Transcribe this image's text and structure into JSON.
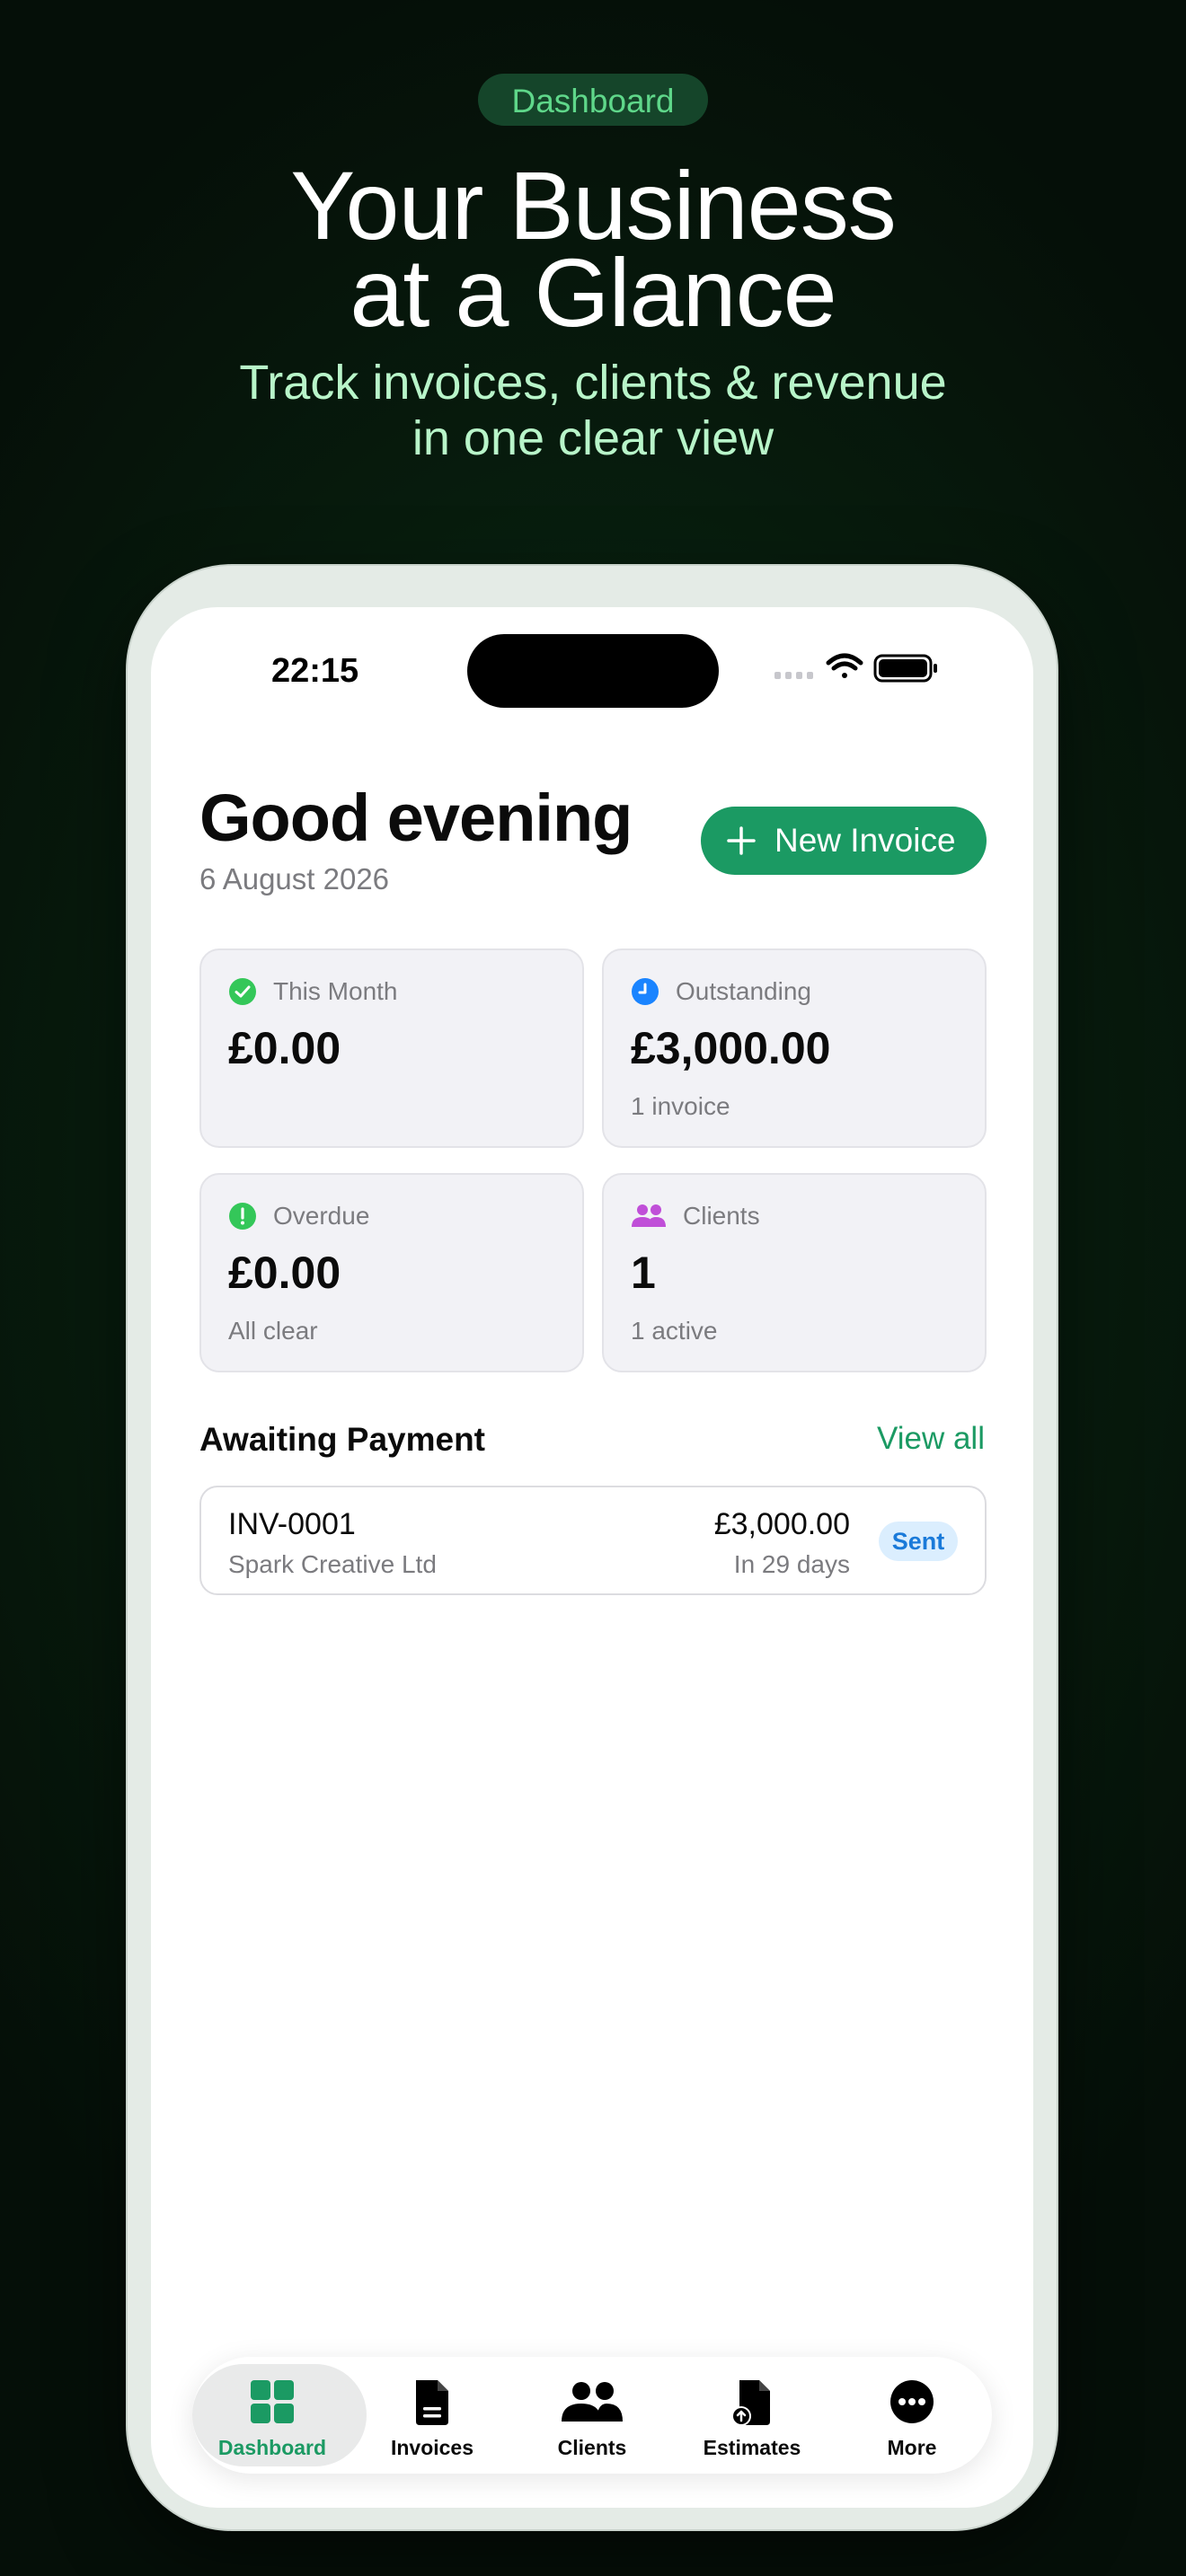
{
  "hero": {
    "pill": "Dashboard",
    "title_line1": "Your Business",
    "title_line2": "at a Glance",
    "subtitle_line1": "Track invoices, clients & revenue",
    "subtitle_line2": "in one clear view"
  },
  "status_bar": {
    "time": "22:15",
    "icons": [
      "signal-icon",
      "wifi-icon",
      "battery-icon"
    ]
  },
  "header": {
    "greeting": "Good evening",
    "date": "6 August 2026",
    "new_invoice_label": "New Invoice"
  },
  "stats": {
    "this_month": {
      "label": "This Month",
      "value": "£0.00",
      "sub": "",
      "icon": "check-circle-icon",
      "color": "#34c759"
    },
    "outstanding": {
      "label": "Outstanding",
      "value": "£3,000.00",
      "sub": "1 invoice",
      "icon": "clock-icon",
      "color": "#1a84ff"
    },
    "overdue": {
      "label": "Overdue",
      "value": "£0.00",
      "sub": "All clear",
      "icon": "exclamation-circle-icon",
      "color": "#34c759"
    },
    "clients": {
      "label": "Clients",
      "value": "1",
      "sub": "1 active",
      "icon": "people-icon",
      "color": "#c04fd8"
    }
  },
  "awaiting": {
    "title": "Awaiting Payment",
    "view_all": "View all",
    "invoices": [
      {
        "number": "INV-0001",
        "client": "Spark Creative Ltd",
        "amount": "£3,000.00",
        "due": "In 29 days",
        "status": "Sent"
      }
    ]
  },
  "tabbar": {
    "items": [
      {
        "label": "Dashboard",
        "icon": "grid-icon",
        "active": true
      },
      {
        "label": "Invoices",
        "icon": "document-icon",
        "active": false
      },
      {
        "label": "Clients",
        "icon": "people-icon",
        "active": false
      },
      {
        "label": "Estimates",
        "icon": "estimate-icon",
        "active": false
      },
      {
        "label": "More",
        "icon": "more-icon",
        "active": false
      }
    ]
  },
  "colors": {
    "accent": "#1b9a63",
    "background": "#071a0d",
    "badge_bg": "#dbeefe",
    "badge_text": "#1a7ad9"
  }
}
